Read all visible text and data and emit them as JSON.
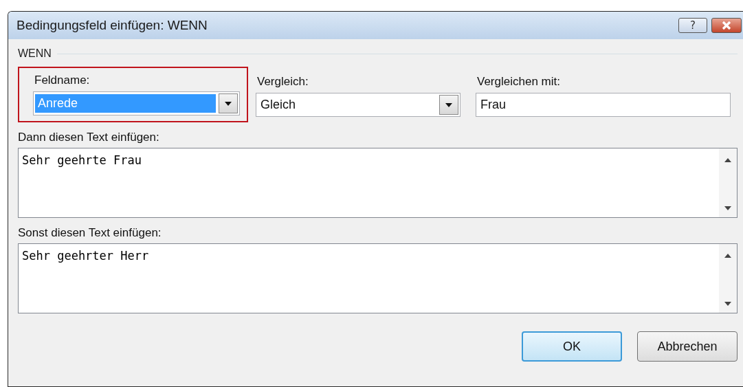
{
  "window": {
    "title": "Bedingungsfeld einfügen: WENN",
    "help_button": "?"
  },
  "group": {
    "label": "WENN"
  },
  "fields": [
    {
      "kind": "combo",
      "label": "Feldname:",
      "value": "Anrede",
      "text_selected": true,
      "highlighted": true
    },
    {
      "kind": "combo",
      "label": "Vergleich:",
      "value": "Gleich",
      "text_selected": false,
      "highlighted": false
    },
    {
      "kind": "text",
      "label": "Vergleichen mit:",
      "value": "Frau",
      "text_selected": false,
      "highlighted": false
    }
  ],
  "text_areas": [
    {
      "label": "Dann diesen Text einfügen:",
      "value": "Sehr geehrte Frau"
    },
    {
      "label": "Sonst diesen Text einfügen:",
      "value": "Sehr geehrter Herr"
    }
  ],
  "buttons": [
    {
      "label": "OK",
      "default": true
    },
    {
      "label": "Abbrechen",
      "default": false
    }
  ]
}
